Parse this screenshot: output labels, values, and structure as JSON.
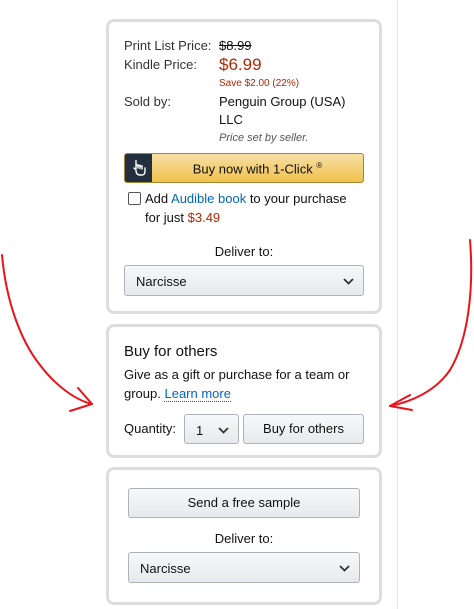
{
  "purchase_box": {
    "print_list_price_label": "Print List Price:",
    "print_list_price": "$8.99",
    "kindle_price_label": "Kindle Price:",
    "kindle_price": "$6.99",
    "savings": "Save $2.00 (22%)",
    "sold_by_label": "Sold by:",
    "sold_by_line1": "Penguin Group (USA)",
    "sold_by_line2": "LLC",
    "price_note": "Price set by seller.",
    "buy_now_label": "Buy now with 1-Click",
    "buy_now_mark": "®",
    "audible_prefix": "Add ",
    "audible_link": "Audible book",
    "audible_suffix": " to your purchase",
    "audible_line2_prefix": "for just ",
    "audible_price": "$3.49",
    "deliver_to_label": "Deliver to:",
    "deliver_to_value": "Narcisse"
  },
  "buy_for_others": {
    "title": "Buy for others",
    "description_line1": "Give as a gift or purchase for a team or",
    "description_line2_prefix": "group. ",
    "learn_more": "Learn more",
    "quantity_label": "Quantity:",
    "quantity_value": "1",
    "button_label": "Buy for others"
  },
  "sample_box": {
    "send_sample_label": "Send a free sample",
    "deliver_to_label": "Deliver to:",
    "deliver_to_value": "Narcisse"
  },
  "colors": {
    "price_red": "#b12704",
    "link_blue": "#0066c0",
    "one_click_yellow": "#f0c14b",
    "annotation_red": "#e8141a"
  }
}
